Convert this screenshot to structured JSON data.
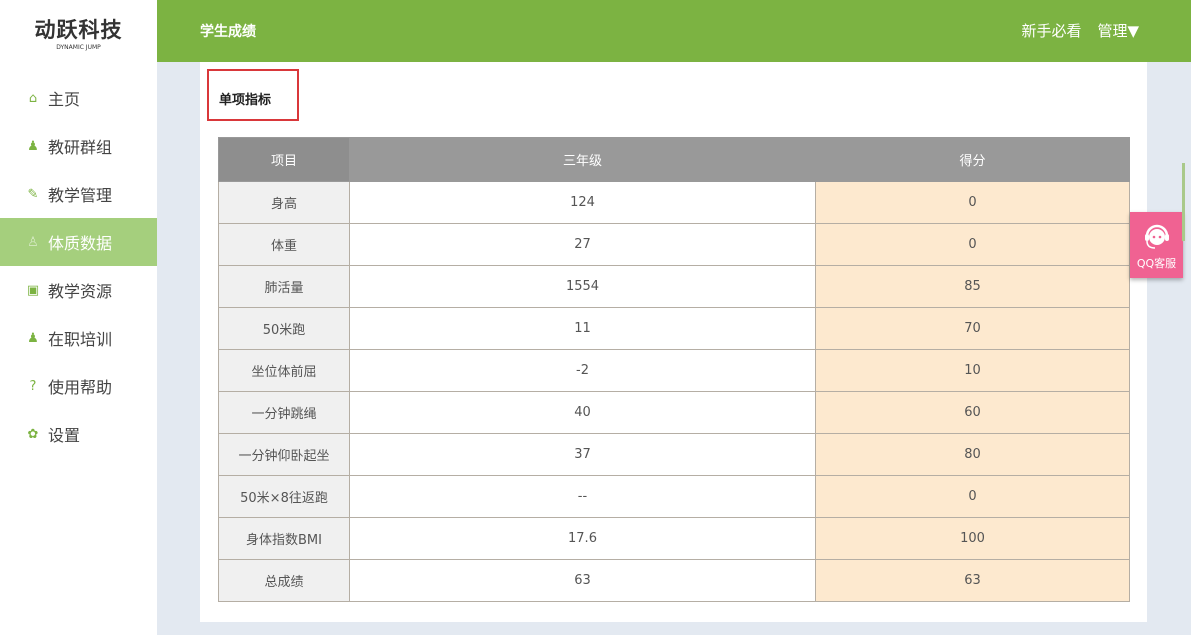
{
  "logo": {
    "title": "动跃科技",
    "subtitle": "DYNAMIC JUMP"
  },
  "sidebar": {
    "items": [
      {
        "label": "主页",
        "icon": "home-icon",
        "glyph": "⌂"
      },
      {
        "label": "教研群组",
        "icon": "users-icon",
        "glyph": "♟"
      },
      {
        "label": "教学管理",
        "icon": "edit-icon",
        "glyph": "✎"
      },
      {
        "label": "体质数据",
        "icon": "figure-icon",
        "glyph": "♙",
        "active": true
      },
      {
        "label": "教学资源",
        "icon": "bag-icon",
        "glyph": "▣"
      },
      {
        "label": "在职培训",
        "icon": "person-icon",
        "glyph": "♟"
      },
      {
        "label": "使用帮助",
        "icon": "help-icon",
        "glyph": "?"
      },
      {
        "label": "设置",
        "icon": "gear-icon",
        "glyph": "✿"
      }
    ]
  },
  "header": {
    "title": "学生成绩",
    "guide": "新手必看",
    "manage": "管理▼"
  },
  "section": {
    "title": "单项指标"
  },
  "table": {
    "headers": [
      "项目",
      "三年级",
      "得分"
    ],
    "rows": [
      [
        "身高",
        "124",
        "0"
      ],
      [
        "体重",
        "27",
        "0"
      ],
      [
        "肺活量",
        "1554",
        "85"
      ],
      [
        "50米跑",
        "11",
        "70"
      ],
      [
        "坐位体前屈",
        "-2",
        "10"
      ],
      [
        "一分钟跳绳",
        "40",
        "60"
      ],
      [
        "一分钟仰卧起坐",
        "37",
        "80"
      ],
      [
        "50米×8往返跑",
        "--",
        "0"
      ],
      [
        "身体指数BMI",
        "17.6",
        "100"
      ],
      [
        "总成绩",
        "63",
        "63"
      ]
    ]
  },
  "qq": {
    "label": "QQ客服"
  }
}
